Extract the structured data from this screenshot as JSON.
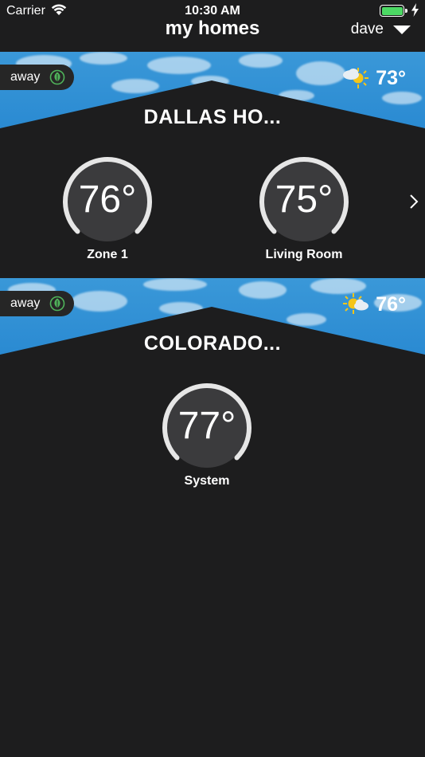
{
  "status_bar": {
    "carrier": "Carrier",
    "time": "10:30 AM"
  },
  "nav": {
    "title": "my homes",
    "user": "dave"
  },
  "homes": [
    {
      "name": "DALLAS HO...",
      "mode": "away",
      "weather_temp": "73°",
      "weather_icon": "partly-cloudy-icon",
      "zones": [
        {
          "name": "Zone 1",
          "temp": "76°"
        },
        {
          "name": "Living Room",
          "temp": "75°"
        }
      ]
    },
    {
      "name": "COLORADO...",
      "mode": "away",
      "weather_temp": "76°",
      "weather_icon": "partly-cloudy-icon",
      "zones": [
        {
          "name": "System",
          "temp": "77°"
        }
      ]
    }
  ],
  "colors": {
    "background": "#1d1d1e",
    "sky": "#2a8ad2",
    "leaf": "#4fb35a",
    "battery": "#4cd964"
  }
}
